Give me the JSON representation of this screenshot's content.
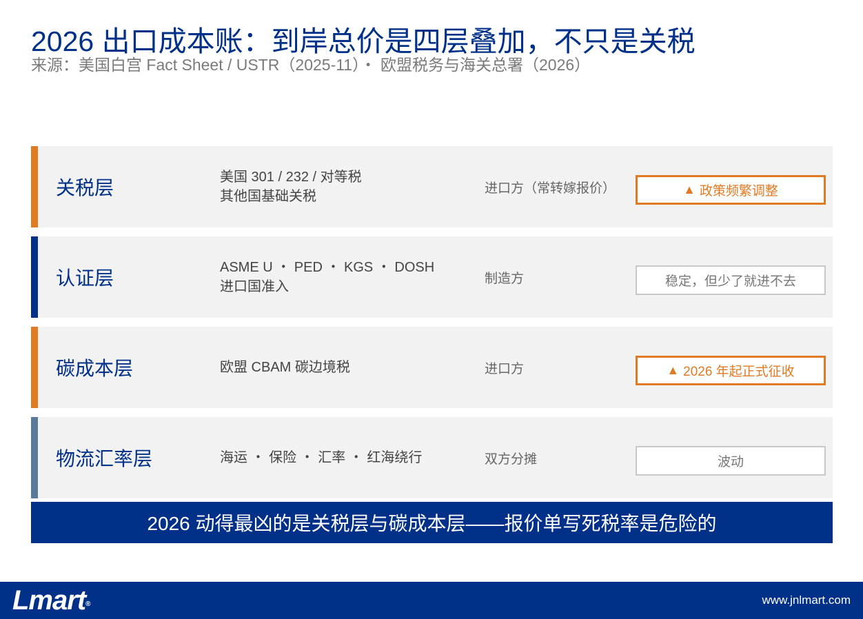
{
  "header": {
    "title": "2026 出口成本账：到岸总价是四层叠加，不只是关税",
    "subtitle": "来源：美国白宫 Fact Sheet / USTR（2025-11）・ 欧盟税务与海关总署（2026）"
  },
  "layers": [
    {
      "name": "关税层",
      "desc_line1": "美国 301 / 232 / 对等税",
      "desc_line2": "其他国基础关税",
      "bearer": "进口方（常转嫁报价）",
      "status": "政策频繁调整",
      "status_icon": "warning-triangle-icon",
      "accent": "#e07b24"
    },
    {
      "name": "认证层",
      "desc_line1": "ASME U ・ PED ・ KGS ・ DOSH",
      "desc_line2": "进口国准入",
      "bearer": "制造方",
      "status": "稳定，但少了就进不去",
      "accent": "#003087"
    },
    {
      "name": "碳成本层",
      "desc_line1": "欧盟 CBAM 碳边境税",
      "bearer": "进口方",
      "status": "2026 年起正式征收",
      "status_icon": "warning-triangle-icon",
      "accent": "#e07b24"
    },
    {
      "name": "物流汇率层",
      "desc_line1": "海运 ・ 保险 ・ 汇率 ・ 红海绕行",
      "bearer": "双方分摊",
      "status": "波动",
      "accent": "#5a7a99"
    }
  ],
  "banner": {
    "text": "2026 动得最凶的是关税层与碳成本层——报价单写死税率是危险的"
  },
  "footer": {
    "logo": "Lmart",
    "logo_mark": "®",
    "url": "www.jnlmart.com"
  },
  "colors": {
    "brand_blue": "#003087",
    "warning_orange": "#e07b24",
    "slate": "#5a7a99",
    "row_bg": "#f2f2f2"
  }
}
